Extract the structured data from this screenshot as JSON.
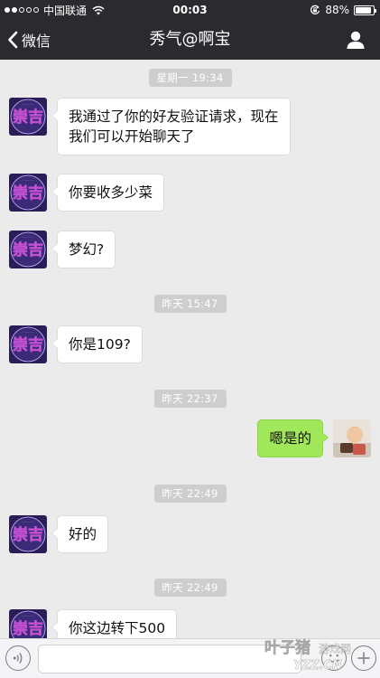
{
  "status_bar": {
    "carrier": "中国联通",
    "time": "00:03",
    "battery": "88%",
    "battery_level": 0.88,
    "signal_bars_filled": 2,
    "signal_bars_total": 5
  },
  "nav": {
    "back_label": "微信",
    "title": "秀气@啊宝"
  },
  "messages": [
    {
      "type": "timestamp",
      "text": "星期一 19:34"
    },
    {
      "type": "incoming",
      "text_lines": [
        "我通过了你的好友验证请求，现在",
        "我们可以开始聊天了"
      ]
    },
    {
      "type": "incoming",
      "text": "你要收多少菜"
    },
    {
      "type": "incoming",
      "text": "梦幻?"
    },
    {
      "type": "timestamp",
      "text": "昨天 15:47"
    },
    {
      "type": "incoming",
      "text": "你是109?"
    },
    {
      "type": "timestamp",
      "text": "昨天 22:37"
    },
    {
      "type": "outgoing",
      "text": "嗯是的"
    },
    {
      "type": "timestamp",
      "text": "昨天 22:49"
    },
    {
      "type": "incoming",
      "text": "好的"
    },
    {
      "type": "timestamp",
      "text": "昨天 22:49"
    },
    {
      "type": "incoming",
      "text": "你这边转下500"
    }
  ],
  "avatar": {
    "logo_text": "崇吉"
  },
  "input": {
    "value": ""
  },
  "colors": {
    "bar": "#2b2b2f",
    "background": "#ebebeb",
    "outgoing_bubble": "#a0e75a",
    "incoming_bubble": "#ffffff",
    "timestamp_bg": "#cecece"
  },
  "icons": {
    "back": "chevron-left-icon",
    "profile": "person-icon",
    "voice": "voice-icon",
    "emoji": "smiley-icon",
    "plus": "plus-icon",
    "wifi": "wifi-icon",
    "lock": "rotation-lock-icon"
  },
  "watermark": {
    "text": "叶子猪游戏网",
    "site": "YZZ.CN"
  }
}
